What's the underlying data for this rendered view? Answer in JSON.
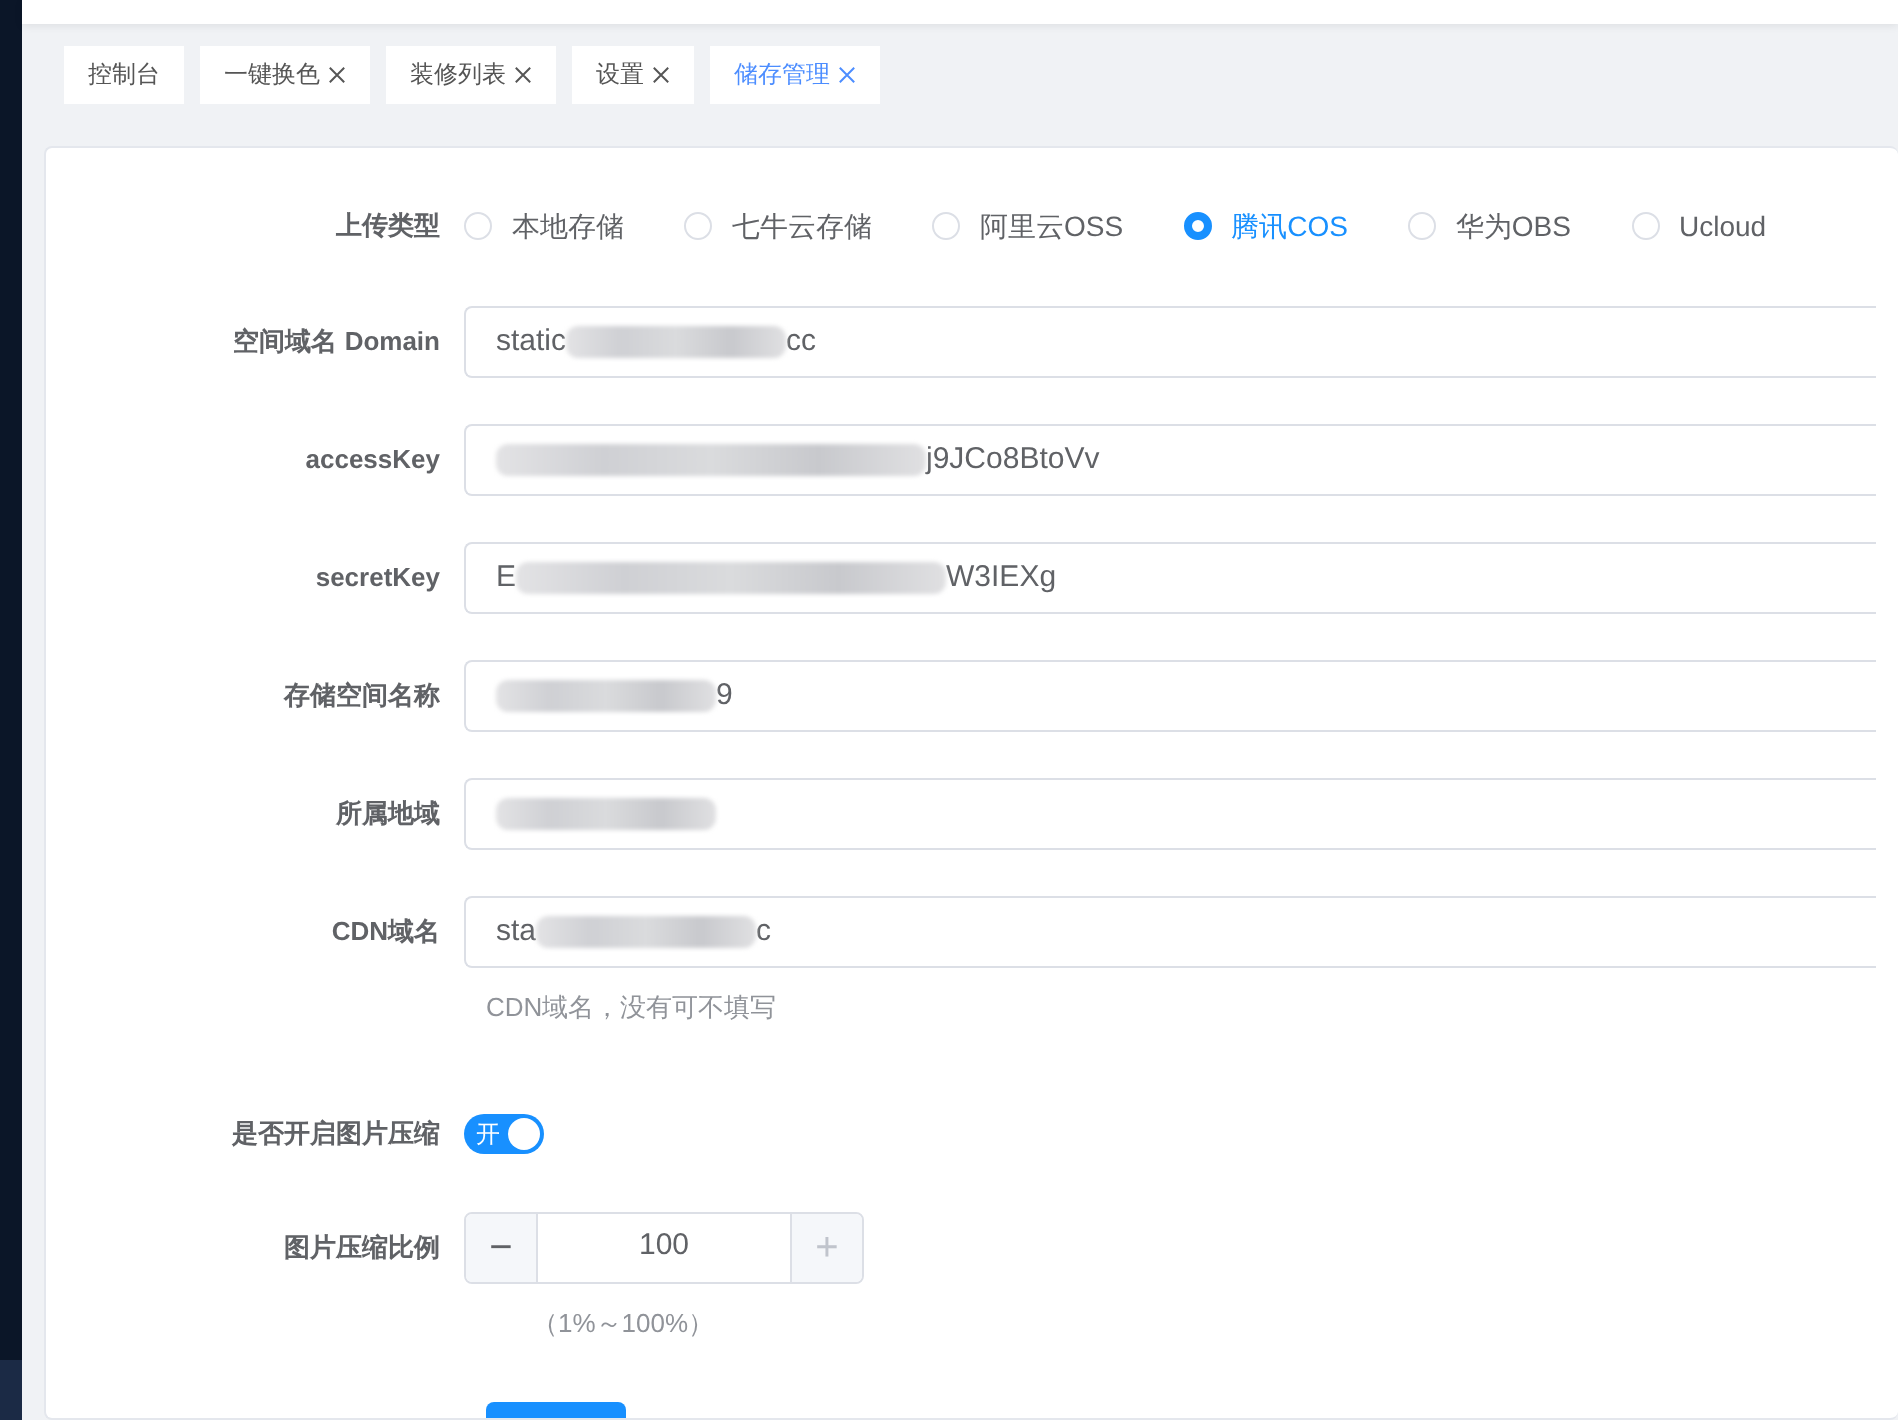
{
  "tabs": [
    {
      "label": "控制台",
      "closable": false,
      "selected": false
    },
    {
      "label": "一键换色",
      "closable": true,
      "selected": false
    },
    {
      "label": "装修列表",
      "closable": true,
      "selected": false
    },
    {
      "label": "设置",
      "closable": true,
      "selected": false
    },
    {
      "label": "储存管理",
      "closable": true,
      "selected": true
    }
  ],
  "upload_type": {
    "label": "上传类型",
    "options": [
      {
        "label": "本地存储",
        "selected": false
      },
      {
        "label": "七牛云存储",
        "selected": false
      },
      {
        "label": "阿里云OSS",
        "selected": false
      },
      {
        "label": "腾讯COS",
        "selected": true
      },
      {
        "label": "华为OBS",
        "selected": false
      },
      {
        "label": "Ucloud",
        "selected": false
      }
    ]
  },
  "fields": [
    {
      "label": "空间域名 Domain",
      "value_start": "static",
      "value_end": "cc",
      "redacted": true
    },
    {
      "label": "accessKey",
      "value_end": "j9JCo8BtoVv",
      "redacted": true
    },
    {
      "label": "secretKey",
      "value_start": "E",
      "value_end": "W3IEXg",
      "redacted": true
    },
    {
      "label": "存储空间名称",
      "value_end": "9",
      "redacted": true
    },
    {
      "label": "所属地域",
      "redacted": true
    },
    {
      "label": "CDN域名",
      "value_start": "sta",
      "value_end": "c",
      "redacted": true,
      "hint": "CDN域名，没有可不填写"
    }
  ],
  "compression": {
    "label": "是否开启图片压缩",
    "on": true,
    "on_text": "开"
  },
  "ratio": {
    "label": "图片压缩比例",
    "minus": "−",
    "value": "100",
    "plus": "+",
    "hint": "（1%～100%）"
  }
}
